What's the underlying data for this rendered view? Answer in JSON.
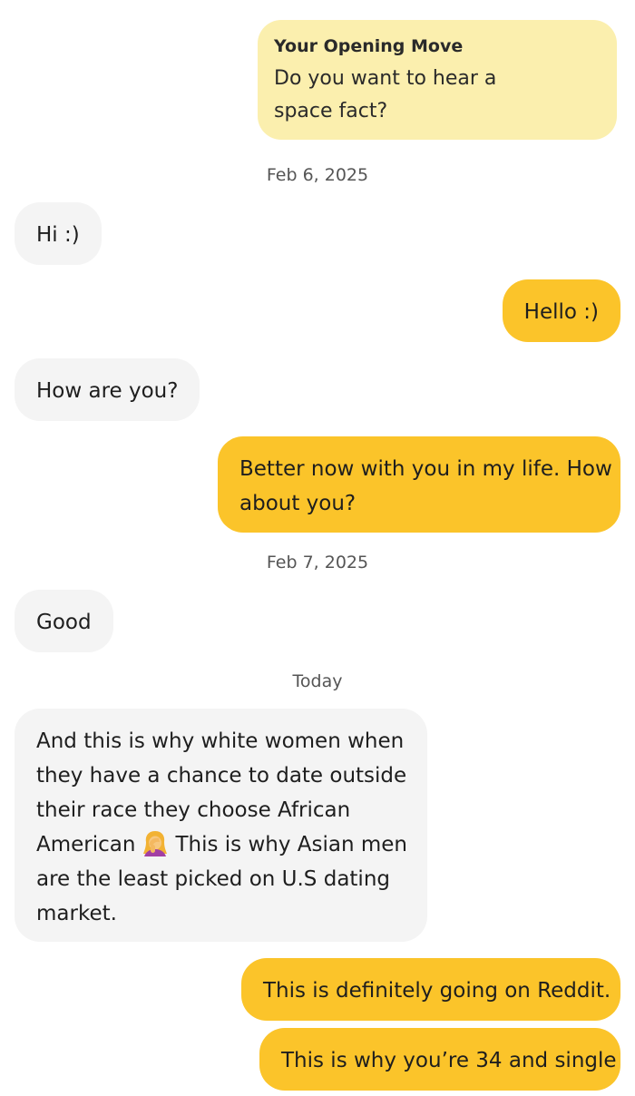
{
  "opening_move": {
    "title": "Your Opening Move",
    "question": "Do you want to hear a space fact?"
  },
  "dates": {
    "first": "Feb 6, 2025",
    "second": "Feb 7, 2025",
    "third": "Today"
  },
  "messages": {
    "hi": "Hi :)",
    "hello": "Hello :)",
    "how_are_you": "How are you?",
    "better_line1": "Better now with you in my life. How",
    "better_line2": "about you?",
    "good": "Good",
    "long_line1": "And this is why white women when",
    "long_line2": "they have a chance to date outside",
    "long_line3": "their race they choose African",
    "long_line4a": "American",
    "long_line4b": "This is why Asian men",
    "long_line5": "are the least picked on U.S dating",
    "long_line6": "market.",
    "reddit": "This is definitely going on Reddit.",
    "single": "This is why you’re 34 and single"
  },
  "icons": {
    "emoji": "woman-facepalming-emoji"
  },
  "colors": {
    "outgoing_bubble": "#fbc42a",
    "incoming_bubble": "#f4f4f4",
    "opening_move_bubble": "#fbefae"
  }
}
